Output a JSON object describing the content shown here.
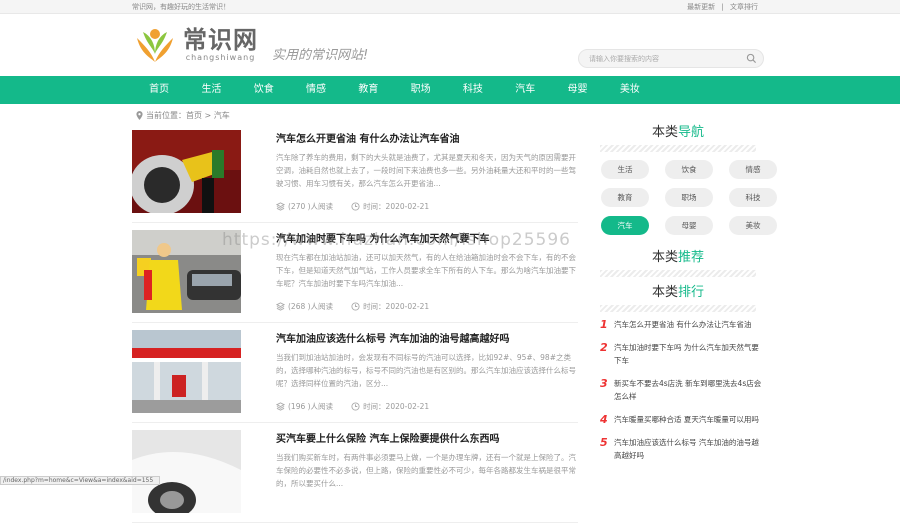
{
  "topbar": {
    "left": "常识网，有趣好玩的生活常识！",
    "links": [
      "最新更新",
      "文章排行"
    ]
  },
  "brand": {
    "name": "常识网",
    "pinyin": "changshiwang",
    "slogan": "实用的常识网站!"
  },
  "search": {
    "placeholder": "请输入你要搜索的内容"
  },
  "nav": [
    "首页",
    "生活",
    "饮食",
    "情感",
    "教育",
    "职场",
    "科技",
    "汽车",
    "母婴",
    "美妆"
  ],
  "breadcrumb": {
    "label": "当前位置：",
    "path": "首页 > 汽车"
  },
  "articles": [
    {
      "title": "汽车怎么开更省油 有什么办法让汽车省油",
      "desc": "汽车除了养车的费用，剩下的大头就是油费了，尤其是夏天和冬天，因为天气的原因需要开空调，油耗自然也就上去了，一段时间下来油费也多一些。另外油耗量大还和平时的一些驾驶习惯、用车习惯有关，那么汽车怎么开更省油...",
      "views": "(270 )人阅读",
      "time": "时间：2020-02-21"
    },
    {
      "title": "汽车加油时要下车吗 为什么汽车加天然气要下车",
      "desc": "现在汽车都在加油站加油，还可以加天然气，有的人在给油箱加油时会不会下车，有的不会下车，但是知道天然气加气站，工作人员要求全车下所有的人下车。那么为啥汽车加油要下车呢？汽车加油时要下车吗汽车加油...",
      "views": "(268 )人阅读",
      "time": "时间：2020-02-21"
    },
    {
      "title": "汽车加油应该选什么标号 汽车加油的油号越高越好吗",
      "desc": "当我们到加油站加油时，会发现有不同标号的汽油可以选择，比如92#、95#、98#之类的，选择哪种汽油的标号，标号不同的汽油也是有区别的。那么汽车加油应该选择什么标号呢？选择同样位置的汽油，区分...",
      "views": "(196 )人阅读",
      "time": "时间：2020-02-21"
    },
    {
      "title": "买汽车要上什么保险 汽车上保险要提供什么东西吗",
      "desc": "当我们购买新车时，有两件事必须要马上做，一个是办理车牌，还有一个就是上保险了。汽车保险的必要性不必多说，但上路，保险的重要性必不可少，每年各路都发生车祸是很平常的，所以要买什么...",
      "views": "",
      "time": ""
    }
  ],
  "sidebar": {
    "nav_title": {
      "plain": "本类",
      "accent": "导航"
    },
    "tags": [
      "生活",
      "饮食",
      "情感",
      "教育",
      "职场",
      "科技",
      "汽车",
      "母婴",
      "美妆"
    ],
    "recommend_title": {
      "plain": "本类",
      "accent": "推荐"
    },
    "rank_title": {
      "plain": "本类",
      "accent": "排行"
    },
    "rank": [
      {
        "num": "1",
        "text": "汽车怎么开更省油 有什么办法让汽车省油"
      },
      {
        "num": "2",
        "text": "汽车加油时要下车吗 为什么汽车加天然气要下车"
      },
      {
        "num": "3",
        "text": "新买车不要去4s店洗 新车到哪里洗去4s店会怎么样"
      },
      {
        "num": "4",
        "text": "汽车暖量买哪种合适 夏天汽车暖量可以用吗"
      },
      {
        "num": "5",
        "text": "汽车加油应该选什么标号 汽车加油的油号越高越好吗"
      }
    ]
  },
  "watermark": "https://www.huzhan.com/ishop25596",
  "statusbar": "/index.php?m=home&c=View&a=index&aid=155",
  "colors": {
    "accent": "#14b98a",
    "rank_number": "#e33333"
  }
}
